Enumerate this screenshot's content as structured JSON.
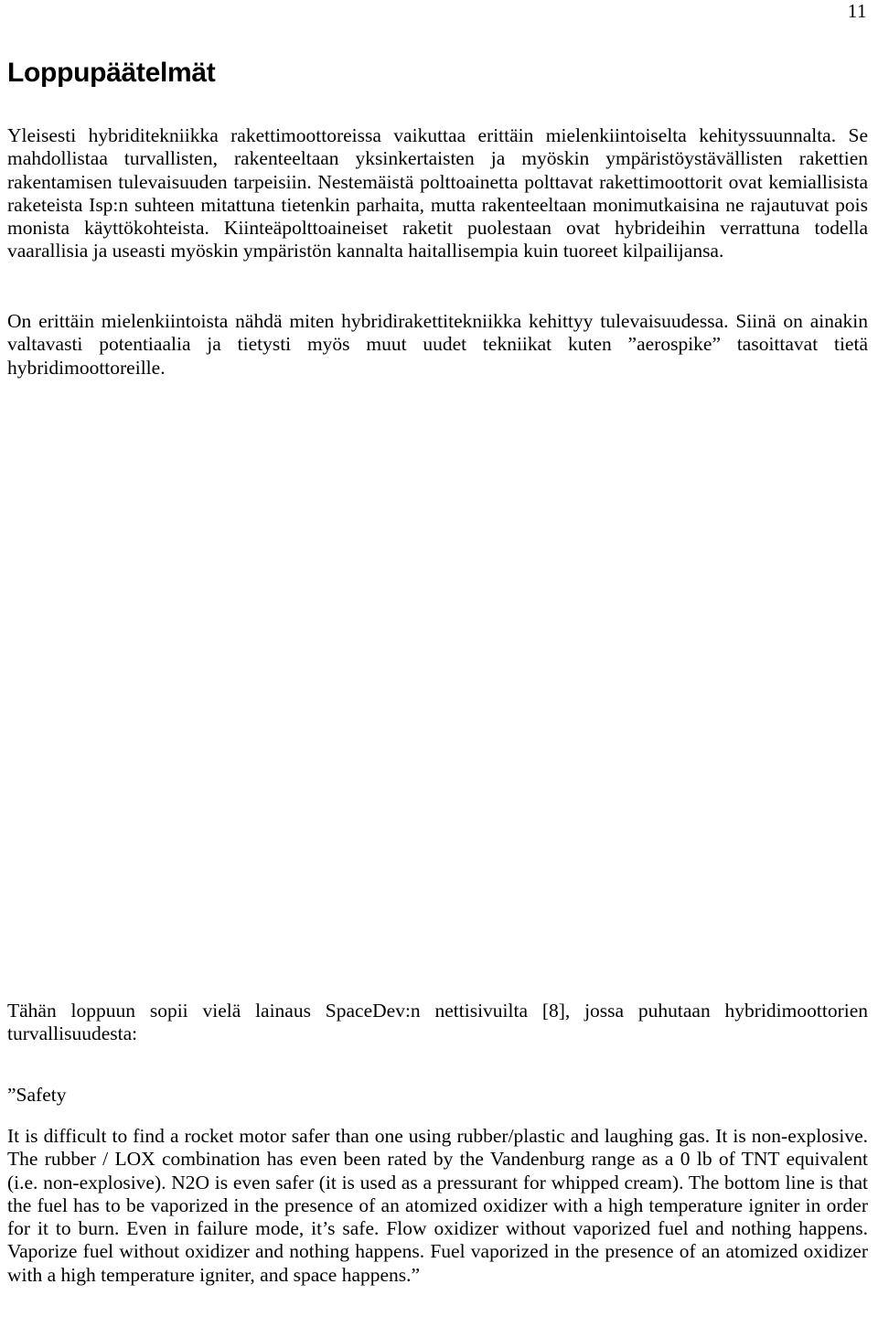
{
  "document": {
    "page_number": "11",
    "heading": "Loppupäätelmät",
    "paragraphs": {
      "p1": "Yleisesti hybriditekniikka rakettimoottoreissa vaikuttaa erittäin mielenkiintoiselta kehityssuunnalta. Se mahdollistaa turvallisten, rakenteeltaan yksinkertaisten ja myöskin ympäristöystävällisten rakettien rakentamisen tulevaisuuden tarpeisiin. Nestemäistä polttoainetta polttavat rakettimoottorit ovat kemiallisista raketeista Isp:n suhteen mitattuna tietenkin parhaita, mutta rakenteeltaan monimutkaisina ne rajautuvat pois monista käyttökohteista. Kiinteäpolttoaineiset raketit puolestaan ovat hybrideihin verrattuna todella vaarallisia ja useasti myöskin ympäristön kannalta haitallisempia kuin tuoreet kilpailijansa.",
      "p2": "On erittäin mielenkiintoista nähdä miten hybridirakettitekniikka kehittyy tulevaisuudessa. Siinä on ainakin valtavasti potentiaalia ja tietysti myös muut uudet tekniikat kuten ”aerospike” tasoittavat tietä hybridimoottoreille.",
      "p3": "Tähän loppuun sopii vielä lainaus SpaceDev:n nettisivuilta [8], jossa puhutaan hybridimoottorien turvallisuudesta:",
      "p4": "”Safety",
      "p5": "It is difficult to find a rocket motor safer than one using rubber/plastic and laughing gas.  It is non-explosive. The rubber / LOX combination has even been rated by the Vandenburg range as a 0 lb of TNT equivalent (i.e. non-explosive). N2O is even safer (it is used as a pressurant for whipped cream). The bottom line is that the fuel has to be vaporized in the presence of an atomized oxidizer with a high temperature igniter in order for it to burn.  Even in failure mode, it’s safe.  Flow oxidizer without vaporized fuel and nothing happens.  Vaporize fuel without oxidizer and nothing happens. Fuel vaporized in the presence of an atomized oxidizer with a high temperature igniter, and space happens.”"
    }
  }
}
